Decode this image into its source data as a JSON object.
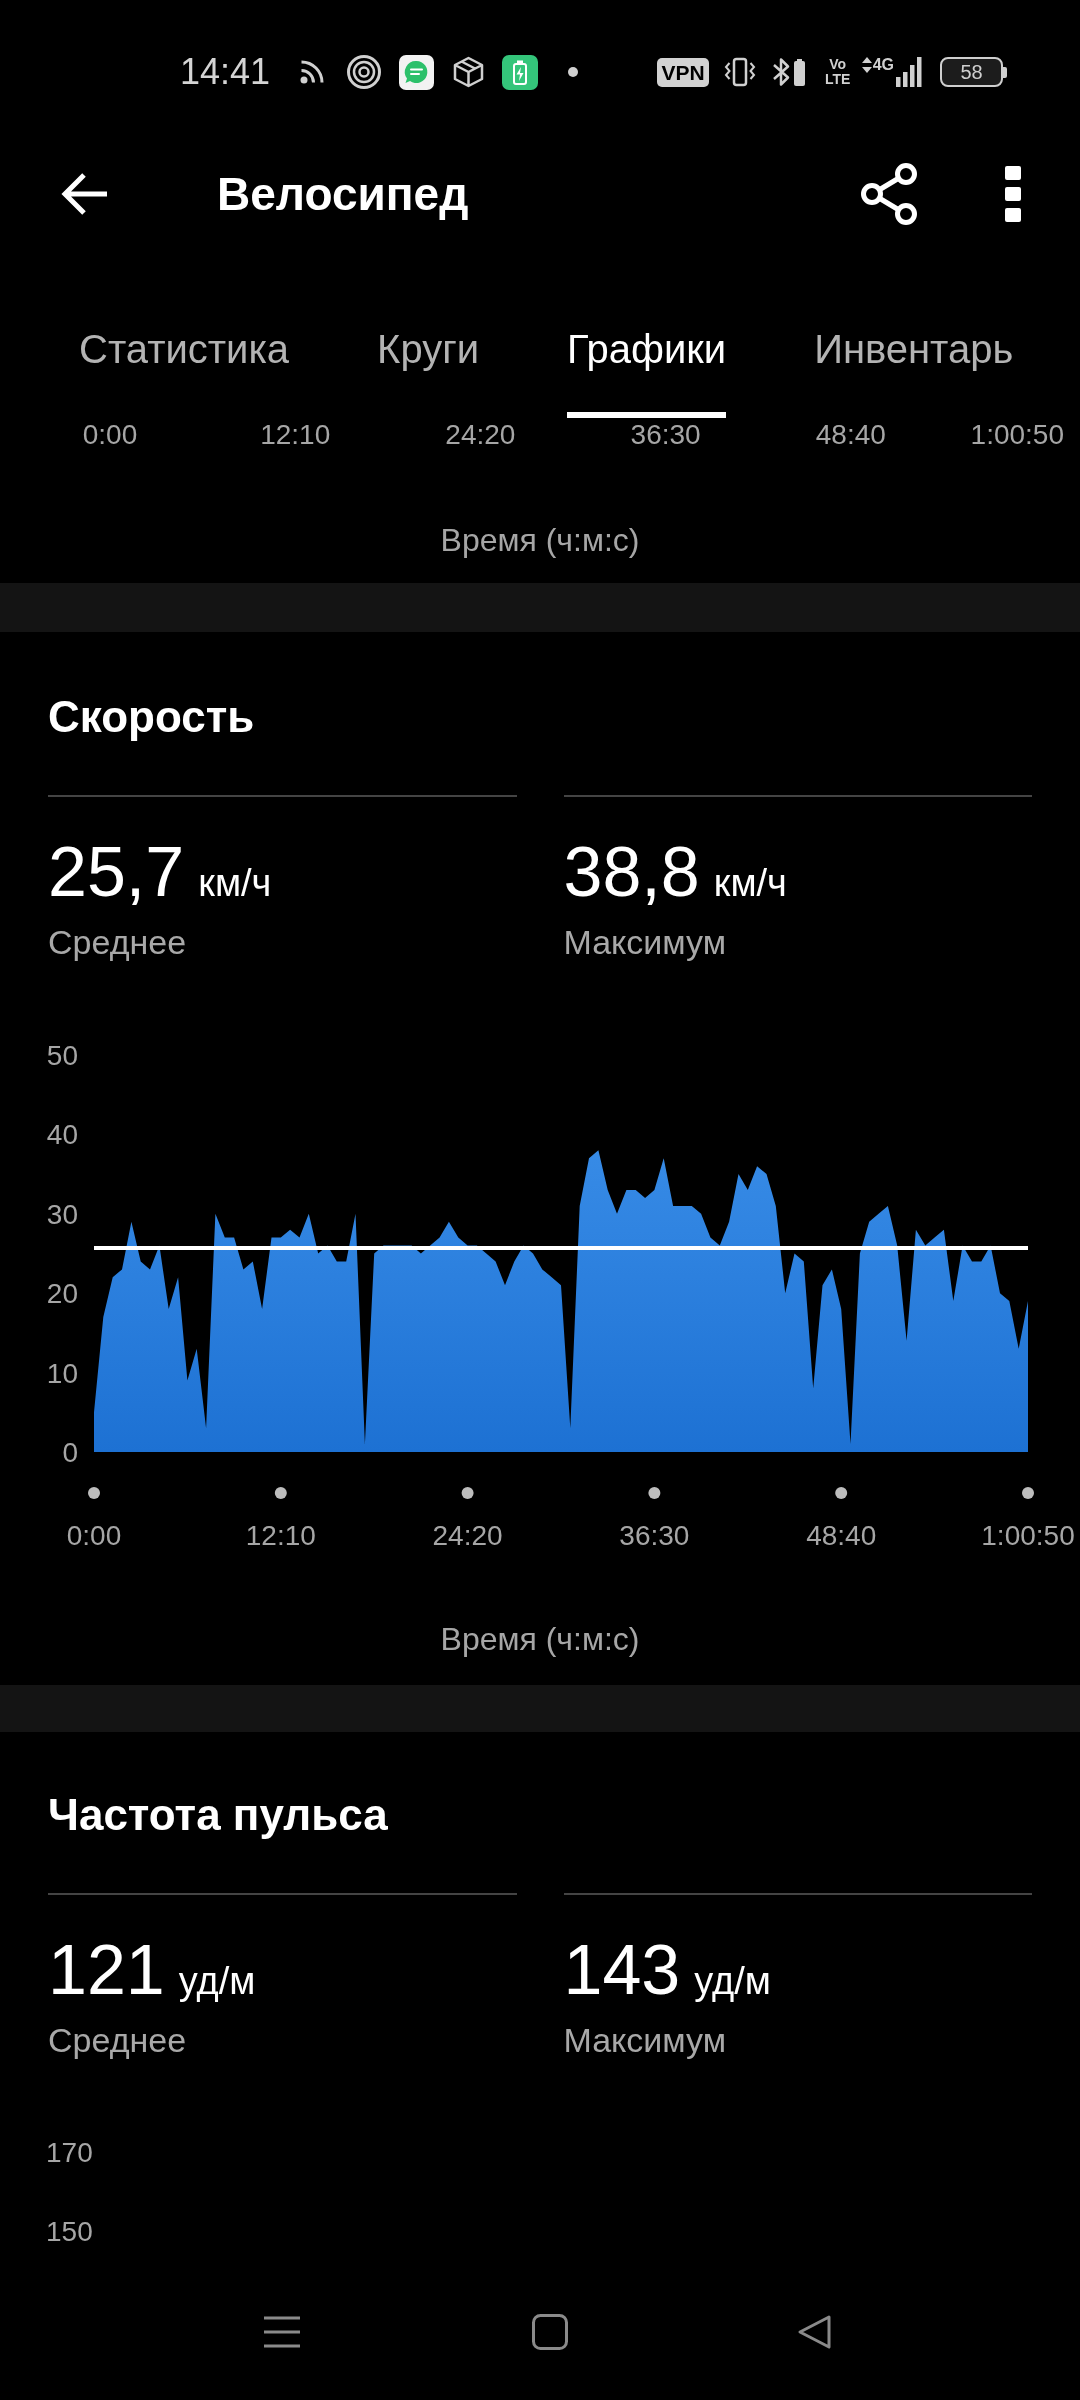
{
  "status_bar": {
    "time": "14:41",
    "vpn": "VPN",
    "volte": "Vo LTE",
    "network": "4G",
    "battery": "58"
  },
  "header": {
    "title": "Велосипед"
  },
  "tabs": [
    {
      "label": "Статистика",
      "selected": false
    },
    {
      "label": "Круги",
      "selected": false
    },
    {
      "label": "Графики",
      "selected": true
    },
    {
      "label": "Инвентарь",
      "selected": false
    }
  ],
  "previous_chart_axis": {
    "xticks": [
      "0:00",
      "12:10",
      "24:20",
      "36:30",
      "48:40",
      "1:00:50"
    ],
    "xlabel": "Время (ч:м:с)"
  },
  "speed": {
    "title": "Скорость",
    "stats": [
      {
        "value": "25,7",
        "unit": "км/ч",
        "label": "Среднее"
      },
      {
        "value": "38,8",
        "unit": "км/ч",
        "label": "Максимум"
      }
    ],
    "chart_data": {
      "type": "area",
      "xlabel": "Время (ч:м:с)",
      "ylim": [
        0,
        50
      ],
      "yticks": [
        {
          "value": 0,
          "label": "0"
        },
        {
          "value": 10,
          "label": "10"
        },
        {
          "value": 20,
          "label": "20"
        },
        {
          "value": 30,
          "label": "30"
        },
        {
          "value": 40,
          "label": "40"
        },
        {
          "value": 50,
          "label": "50"
        }
      ],
      "categories": [
        "0:00",
        null,
        null,
        null,
        null,
        null,
        null,
        null,
        null,
        null,
        null,
        null,
        null,
        null,
        null,
        null,
        null,
        null,
        null,
        null,
        "12:10",
        null,
        null,
        null,
        null,
        null,
        null,
        null,
        null,
        null,
        null,
        null,
        null,
        null,
        null,
        null,
        null,
        null,
        null,
        null,
        "24:20",
        null,
        null,
        null,
        null,
        null,
        null,
        null,
        null,
        null,
        null,
        null,
        null,
        null,
        null,
        null,
        null,
        null,
        null,
        null,
        "36:30",
        null,
        null,
        null,
        null,
        null,
        null,
        null,
        null,
        null,
        null,
        null,
        null,
        null,
        null,
        null,
        null,
        null,
        null,
        null,
        "48:40",
        null,
        null,
        null,
        null,
        null,
        null,
        null,
        null,
        null,
        null,
        null,
        null,
        null,
        null,
        null,
        null,
        null,
        null,
        null,
        "1:00:50"
      ],
      "values": [
        5,
        17,
        22,
        23,
        29,
        24,
        23,
        26,
        18,
        22,
        9,
        13,
        3,
        30,
        27,
        27,
        23,
        24,
        18,
        27,
        27,
        28,
        27,
        30,
        25,
        26,
        24,
        24,
        30,
        1,
        25,
        26,
        26,
        26,
        26,
        25,
        26,
        27,
        29,
        27,
        26,
        26,
        25,
        24,
        21,
        24,
        26,
        25,
        23,
        22,
        21,
        3,
        31,
        37,
        38,
        33,
        30,
        33,
        33,
        32,
        33,
        37,
        31,
        31,
        31,
        30,
        27,
        26,
        29,
        35,
        33,
        36,
        35,
        31,
        20,
        25,
        24,
        8,
        21,
        23,
        18,
        1,
        25,
        29,
        30,
        31,
        26,
        14,
        28,
        26,
        27,
        28,
        19,
        26,
        24,
        24,
        26,
        20,
        19,
        13,
        19
      ],
      "ref_lines": [
        {
          "axis": "y",
          "value": 25.7
        }
      ]
    }
  },
  "heart_rate": {
    "title": "Частота пульса",
    "stats": [
      {
        "value": "121",
        "unit": "уд/м",
        "label": "Среднее"
      },
      {
        "value": "143",
        "unit": "уд/м",
        "label": "Максимум"
      }
    ],
    "axis_labels": [
      "170",
      "150"
    ]
  }
}
